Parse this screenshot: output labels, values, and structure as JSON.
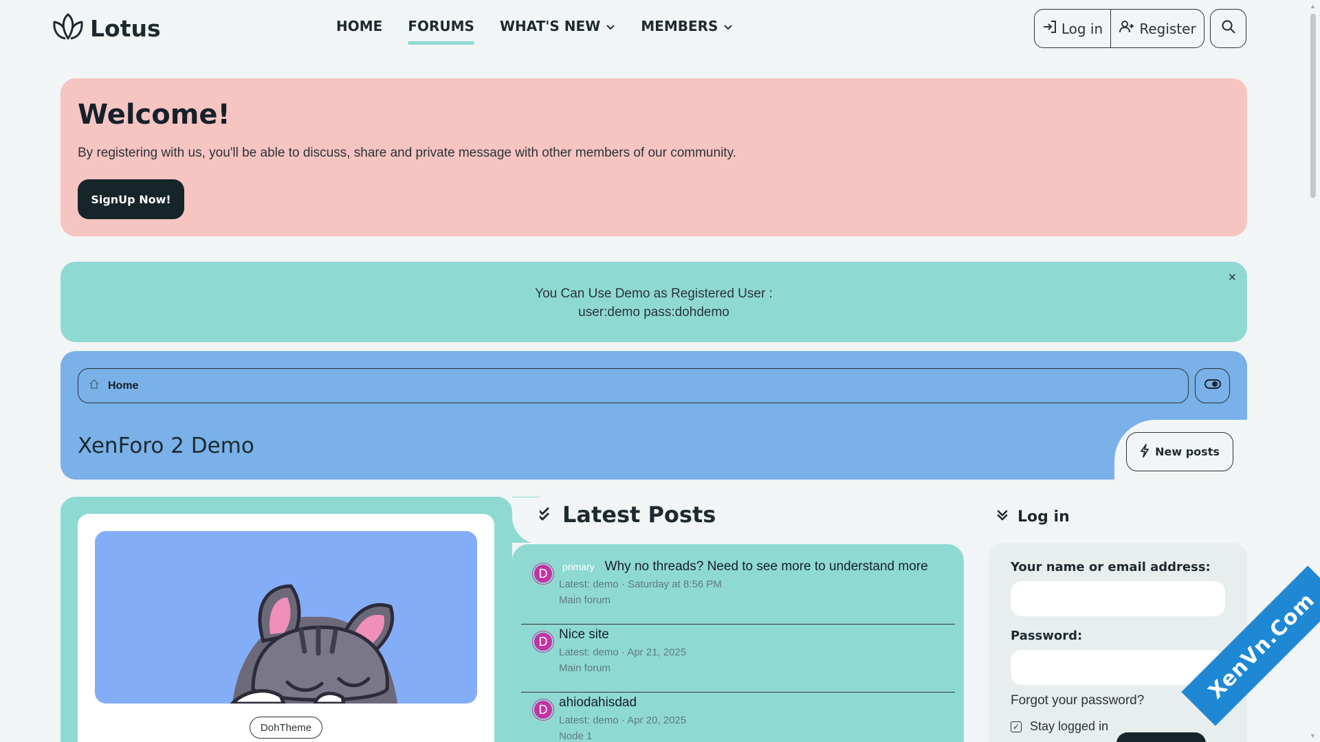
{
  "header": {
    "logo_text": "Lotus",
    "nav": [
      {
        "label": "HOME",
        "active": false,
        "dropdown": false
      },
      {
        "label": "FORUMS",
        "active": true,
        "dropdown": false
      },
      {
        "label": "WHAT'S NEW",
        "active": false,
        "dropdown": true
      },
      {
        "label": "MEMBERS",
        "active": false,
        "dropdown": true
      }
    ],
    "login_label": "Log in",
    "register_label": "Register"
  },
  "welcome": {
    "title": "Welcome!",
    "text": "By registering with us, you'll be able to discuss, share and private message with other members of our community.",
    "signup_label": "SignUp Now!"
  },
  "notice": {
    "line1": "You Can Use Demo as Registered User :",
    "line2": "user:demo pass:dohdemo",
    "close_glyph": "×"
  },
  "hero": {
    "breadcrumb": "Home",
    "title": "XenForo 2 Demo",
    "new_posts_label": "New posts"
  },
  "left_card": {
    "tag_label": "DohTheme"
  },
  "latest_posts": {
    "title": "Latest Posts",
    "items": [
      {
        "avatar": "D",
        "prefix": "primary",
        "title": "Why no threads? Need to see more to understand more",
        "meta": "Latest: demo · Saturday at 8:56 PM",
        "forum": "Main forum"
      },
      {
        "avatar": "D",
        "prefix": "",
        "title": "Nice site",
        "meta": "Latest: demo · Apr 21, 2025",
        "forum": "Main forum"
      },
      {
        "avatar": "D",
        "prefix": "",
        "title": "ahiodahisdad",
        "meta": "Latest: demo · Apr 20, 2025",
        "forum": "Node 1"
      }
    ]
  },
  "login_widget": {
    "title": "Log in",
    "name_label": "Your name or email address:",
    "password_label": "Password:",
    "forgot_label": "Forgot your password?",
    "stay_label": "Stay logged in"
  },
  "watermark": "XenVn.Com",
  "colors": {
    "welcome_bg": "#f6c4c1",
    "notice_bg": "#8fd9d3",
    "hero_bg": "#7ab1e8",
    "dark_button": "#16252a",
    "avatar_bg": "#c532a6"
  }
}
